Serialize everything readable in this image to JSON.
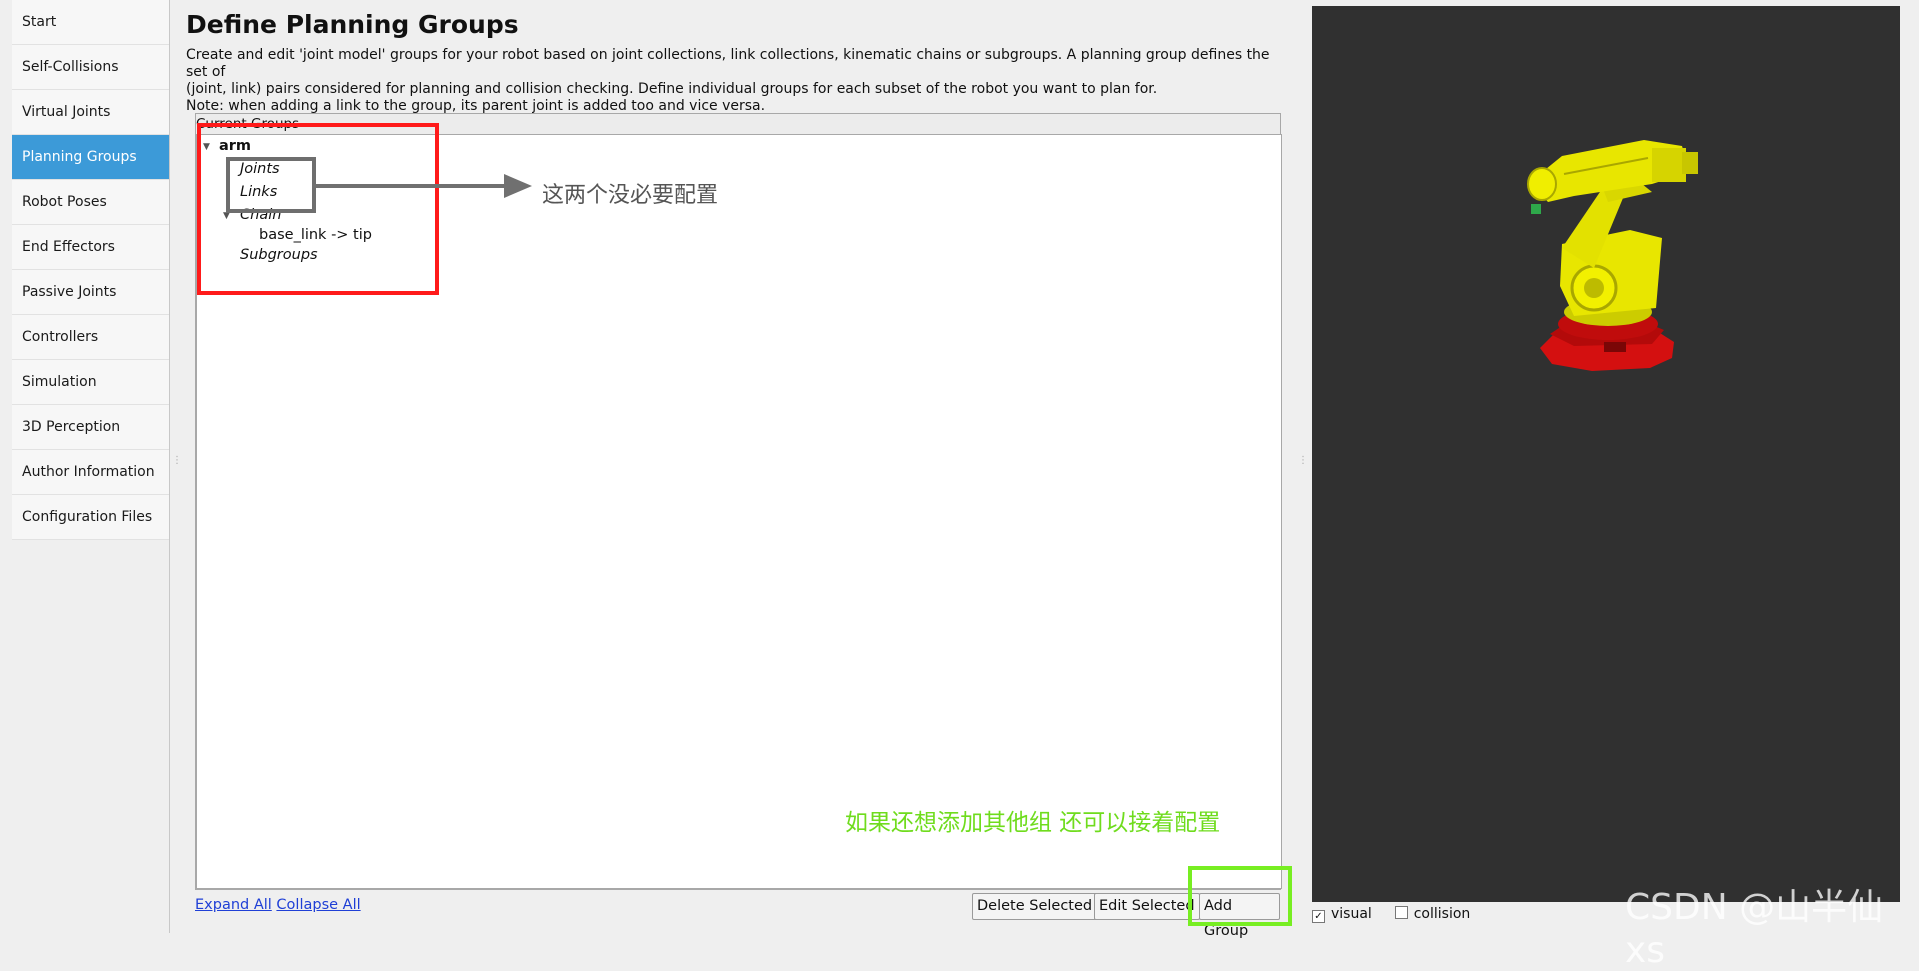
{
  "sidebar": {
    "items": [
      {
        "label": "Start"
      },
      {
        "label": "Self-Collisions"
      },
      {
        "label": "Virtual Joints"
      },
      {
        "label": "Planning Groups"
      },
      {
        "label": "Robot Poses"
      },
      {
        "label": "End Effectors"
      },
      {
        "label": "Passive Joints"
      },
      {
        "label": "Controllers"
      },
      {
        "label": "Simulation"
      },
      {
        "label": "3D Perception"
      },
      {
        "label": "Author Information"
      },
      {
        "label": "Configuration Files"
      }
    ],
    "active_index": 3
  },
  "main": {
    "title": "Define Planning Groups",
    "description_line1": "Create and edit 'joint model' groups for your robot based on joint collections, link collections, kinematic chains or subgroups. A planning group defines the set of",
    "description_line2": "(joint, link) pairs considered for planning and collision checking. Define individual groups for each subset of the robot you want to plan for.",
    "description_line3": "Note: when adding a link to the group, its parent joint is added too and vice versa.",
    "groupbox_title": "Current Groups",
    "tree": {
      "group_name": "arm",
      "joints_label": "Joints",
      "links_label": "Links",
      "chain_label": "Chain",
      "chain_value": "base_link  ->  tip",
      "subgroups_label": "Subgroups"
    },
    "annotation_gray": "这两个没必要配置",
    "annotation_green": "如果还想添加其他组 还可以接着配置",
    "expand_all": "Expand All",
    "collapse_all": "Collapse All",
    "buttons": {
      "delete_selected": "Delete Selected",
      "edit_selected": "Edit Selected",
      "add_group": "Add Group"
    }
  },
  "viewer": {
    "visual_label": "visual",
    "visual_checked": true,
    "collision_label": "collision",
    "collision_checked": false,
    "background_color": "#303030",
    "robot_colors": {
      "arm": "#e8e600",
      "base": "#e01010",
      "tool": "#2ea84a"
    }
  },
  "watermark": "CSDN @山半仙xs"
}
